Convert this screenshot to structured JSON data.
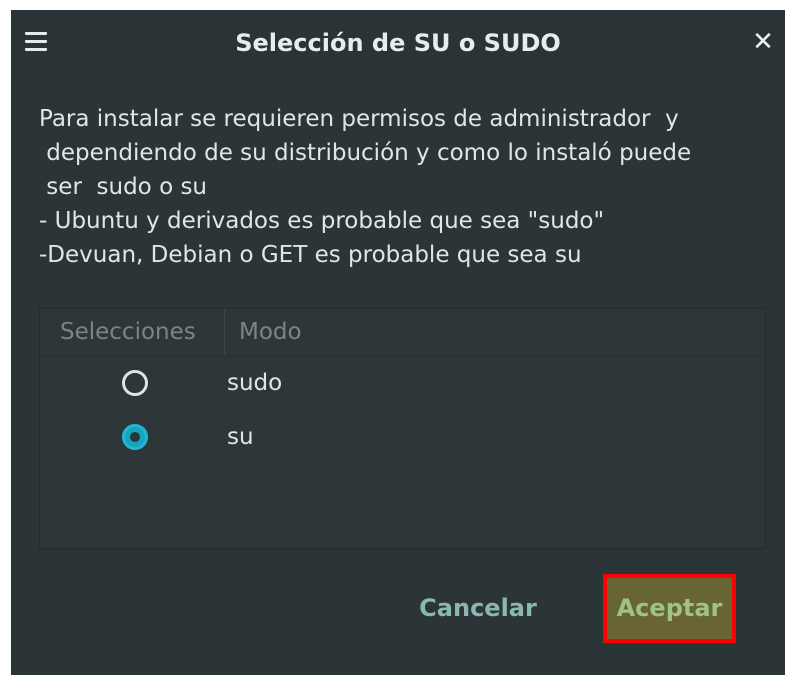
{
  "window": {
    "title": "Selección de SU o SUDO",
    "close_glyph": "✕"
  },
  "message": "Para instalar se requieren permisos de administrador  y\n dependiendo de su distribución y como lo instaló puede\n ser  sudo o su\n- Ubuntu y derivados es probable que sea \"sudo\"\n-Devuan, Debian o GET es probable que sea su",
  "list": {
    "columns": [
      "Selecciones",
      "Modo"
    ],
    "rows": [
      {
        "mode": "sudo",
        "selected": false
      },
      {
        "mode": "su",
        "selected": true
      }
    ]
  },
  "buttons": {
    "cancel": "Cancelar",
    "accept": "Aceptar"
  },
  "icons": {
    "menu": "hamburger-menu-icon",
    "close": "close-icon",
    "radio_unchecked": "radio-unchecked-icon",
    "radio_checked": "radio-checked-icon"
  },
  "colors": {
    "window_bg": "#2b3538",
    "accent": "#16a5bd",
    "accept_bg": "#696434",
    "highlight_border": "#ff0000"
  }
}
